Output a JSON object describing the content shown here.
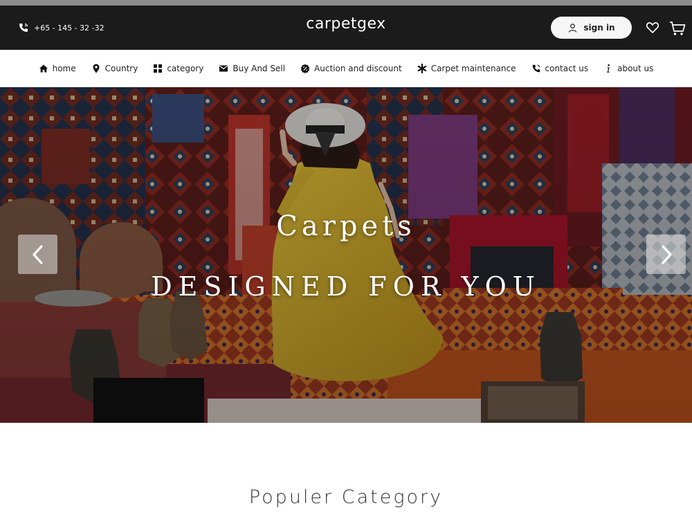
{
  "header": {
    "phone": "+65 - 145 - 32 -32",
    "logo": "carpetgex",
    "signin_label": "sign in",
    "icons": [
      "phone-icon",
      "user-icon",
      "heart-icon",
      "cart-icon"
    ]
  },
  "nav": {
    "items": [
      {
        "label": "home",
        "icon": "home-icon"
      },
      {
        "label": "Country",
        "icon": "location-pin-icon"
      },
      {
        "label": "category",
        "icon": "grid-icon"
      },
      {
        "label": "Buy And Sell",
        "icon": "envelope-icon"
      },
      {
        "label": "Auction and discount",
        "icon": "discount-badge-icon"
      },
      {
        "label": "Carpet maintenance",
        "icon": "asterisk-icon"
      },
      {
        "label": "contact us",
        "icon": "phone-icon"
      },
      {
        "label": "about us",
        "icon": "info-icon"
      }
    ]
  },
  "hero": {
    "title_line1": "Carpets",
    "title_line2": "DESIGNED FOR YOU",
    "prev_icon": "chevron-left-icon",
    "next_icon": "chevron-right-icon"
  },
  "section": {
    "title": "Populer Category"
  },
  "colors": {
    "topbar": "#1b1b1b",
    "accent_yellow": "#d9b52a",
    "rug_red": "#8e2a1f"
  }
}
